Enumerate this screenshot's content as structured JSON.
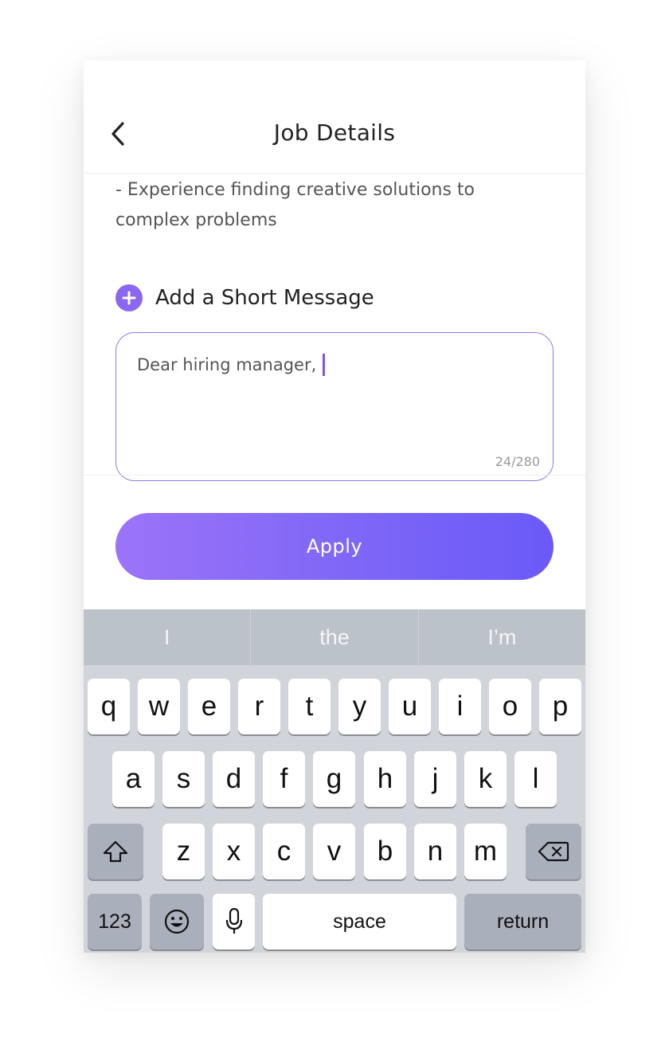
{
  "header": {
    "title": "Job Details",
    "back_icon": "chevron-left-icon"
  },
  "description": {
    "text": "- Experience finding creative solutions to complex problems"
  },
  "message": {
    "add_label": "Add a Short Message",
    "add_icon": "plus-circle-icon",
    "value": "Dear hiring manager,",
    "counter": "24/280"
  },
  "apply": {
    "label": "Apply"
  },
  "keyboard": {
    "suggestions": [
      "I",
      "the",
      "I’m"
    ],
    "row1": [
      "q",
      "w",
      "e",
      "r",
      "t",
      "y",
      "u",
      "i",
      "o",
      "p"
    ],
    "row2": [
      "a",
      "s",
      "d",
      "f",
      "g",
      "h",
      "j",
      "k",
      "l"
    ],
    "row3": [
      "z",
      "x",
      "c",
      "v",
      "b",
      "n",
      "m"
    ],
    "numbers_label": "123",
    "space_label": "space",
    "return_label": "return",
    "shift_icon": "shift-icon",
    "backspace_icon": "backspace-icon",
    "emoji_icon": "emoji-icon",
    "mic_icon": "microphone-icon"
  },
  "colors": {
    "accent": "#8a67f3",
    "button_gradient_start": "#9b74f8",
    "button_gradient_end": "#6a5af8",
    "input_border": "#8d79f0"
  }
}
